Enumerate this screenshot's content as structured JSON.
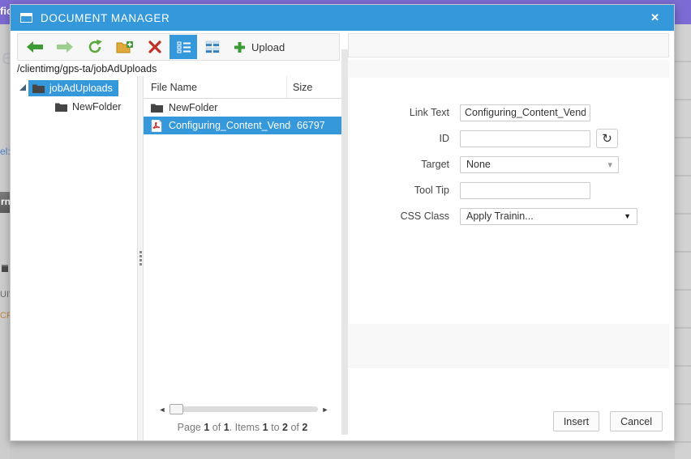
{
  "colors": {
    "accent": "#3498db",
    "titlebar": "#3498db",
    "selection": "#3498db",
    "backdrop_purple": "#7c6bd2"
  },
  "backdrop": {
    "fragments": {
      "header": "fic",
      "big_e": "e",
      "link": "el:",
      "button": "rn",
      "ui": "UI'",
      "cri": "CRI"
    }
  },
  "dialog": {
    "title": "DOCUMENT MANAGER",
    "close_glyph": "✕",
    "toolbar": {
      "upload_label": "Upload",
      "icons": [
        "back",
        "forward",
        "refresh",
        "new-folder",
        "delete",
        "list-view",
        "grid-view",
        "upload"
      ]
    },
    "path": "/clientimg/gps-ta/jobAdUploads",
    "tree": {
      "items": [
        {
          "label": "jobAdUploads",
          "selected": true
        },
        {
          "label": "NewFolder",
          "selected": false
        }
      ]
    },
    "file_list": {
      "columns": {
        "name": "File Name",
        "size": "Size"
      },
      "rows": [
        {
          "name": "NewFolder",
          "size": "",
          "type": "folder",
          "selected": false
        },
        {
          "name": "Configuring_Content_Vendo",
          "size": "66797",
          "type": "pdf",
          "selected": true
        }
      ],
      "scrollbar": {
        "left_arrow": "◄",
        "right_arrow": "►"
      },
      "pager": {
        "p1": "Page",
        "n1": "1",
        "p2": "of",
        "n2": "1",
        "p3": ". Items",
        "n3": "1",
        "p4": "to",
        "n4": "2",
        "p5": "of",
        "n5": "2"
      }
    },
    "form": {
      "link_text": {
        "label": "Link Text",
        "value": "Configuring_Content_Vendor"
      },
      "id": {
        "label": "ID",
        "value": "",
        "refresh_glyph": "↻"
      },
      "target": {
        "label": "Target",
        "value": "None",
        "caret": "▾"
      },
      "tooltip": {
        "label": "Tool Tip",
        "value": ""
      },
      "css_class": {
        "label": "CSS Class",
        "value": "Apply Trainin...",
        "caret": "▼"
      }
    },
    "footer": {
      "insert": "Insert",
      "cancel": "Cancel"
    }
  }
}
